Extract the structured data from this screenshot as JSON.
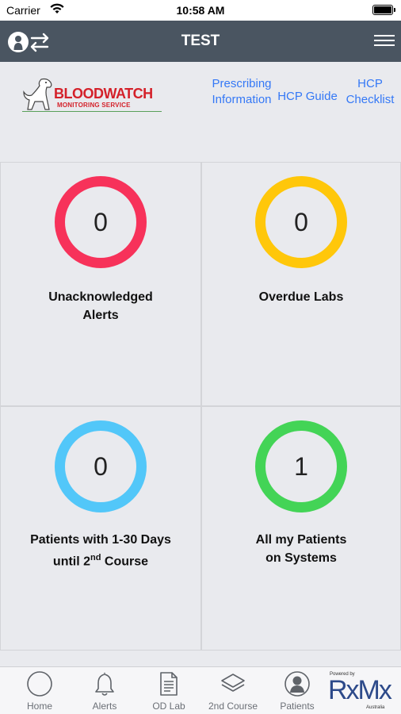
{
  "status_bar": {
    "carrier": "Carrier",
    "time": "10:58 AM"
  },
  "nav": {
    "title": "TEST",
    "left_icon": "switch-user-icon",
    "right_icon": "hamburger-menu-icon"
  },
  "header": {
    "logo": {
      "brand": "BLOODWATCH",
      "subtitle": "MONITORING SERVICE"
    },
    "links": [
      {
        "line1": "Prescribing",
        "line2": "Information"
      },
      {
        "line1": "HCP Guide"
      },
      {
        "line1": "HCP",
        "line2": "Checklist"
      }
    ],
    "link_color": "#3478f6"
  },
  "tiles": [
    {
      "count": "0",
      "label_line1": "Unacknowledged",
      "label_line2": "Alerts",
      "ring_color": "#f7325a"
    },
    {
      "count": "0",
      "label_line1": "Overdue Labs",
      "ring_color": "#ffc70a"
    },
    {
      "count": "0",
      "label_line1": "Patients with 1-30 Days",
      "label_line2_pre": "until 2",
      "label_line2_sup": "nd",
      "label_line2_post": " Course",
      "ring_color": "#52c7f9"
    },
    {
      "count": "1",
      "label_line1": "All my Patients",
      "label_line2": "on Systems",
      "ring_color": "#43d456"
    }
  ],
  "tab_bar": {
    "tabs": [
      {
        "label": "Home",
        "icon": "home-circle-icon"
      },
      {
        "label": "Alerts",
        "icon": "bell-icon"
      },
      {
        "label": "OD Lab",
        "icon": "document-icon"
      },
      {
        "label": "2nd Course",
        "icon": "layers-icon"
      },
      {
        "label": "Patients",
        "icon": "patient-avatar-icon"
      }
    ],
    "sponsor": {
      "powered_by": "Powered by",
      "mark": "RxMx",
      "region": "Australia"
    }
  },
  "colors": {
    "nav_bg": "#4a5561",
    "page_bg": "#e9eaee",
    "tab_icon": "#5f6369"
  }
}
